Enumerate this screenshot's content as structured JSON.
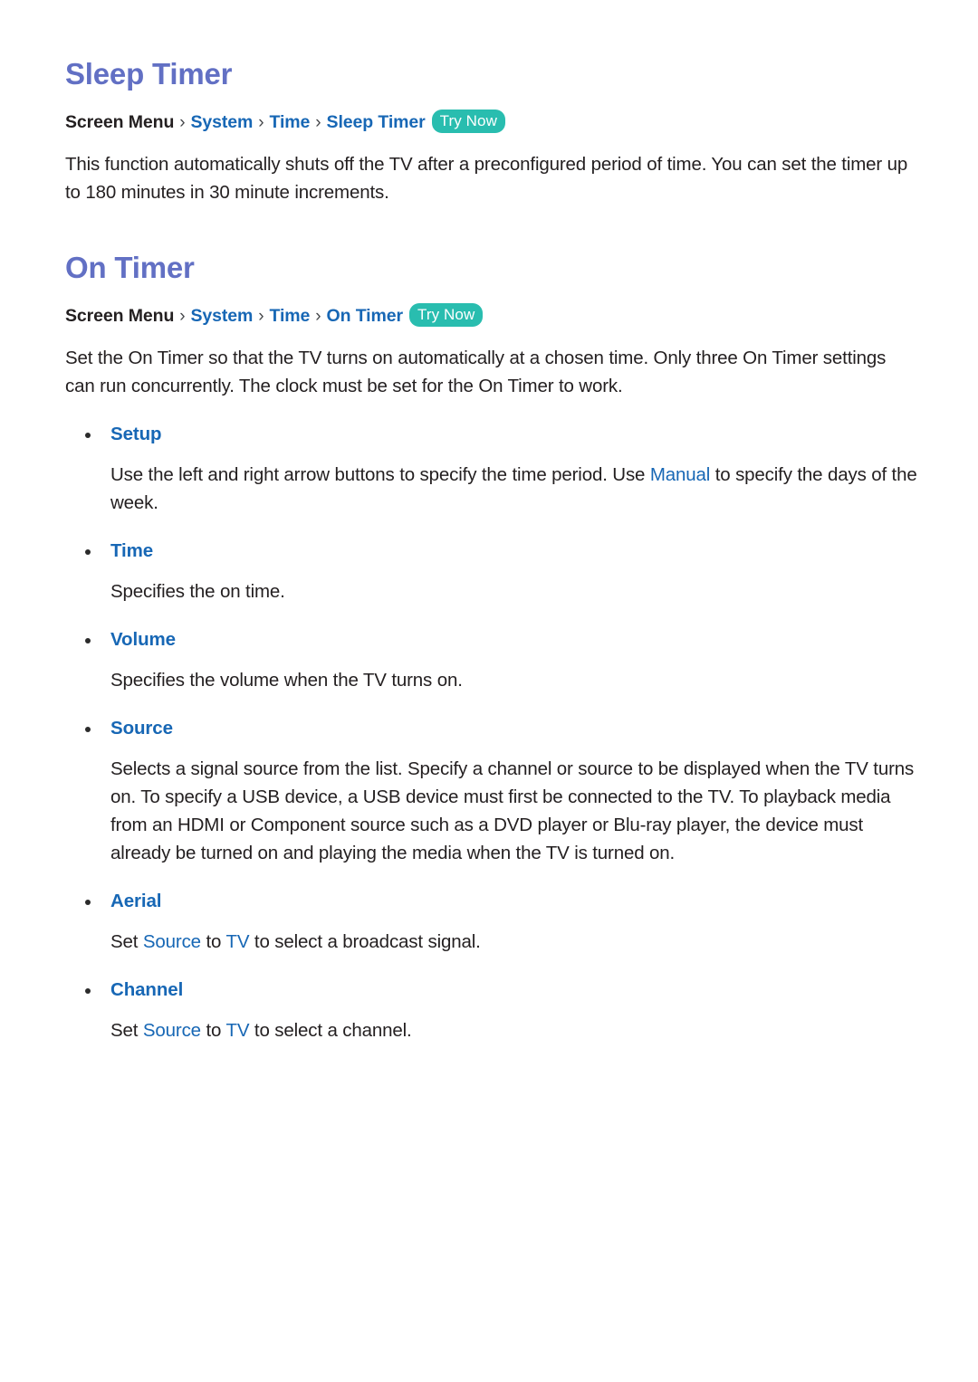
{
  "document": {
    "sections": [
      {
        "id": "sleep-timer",
        "title": "Sleep Timer",
        "breadcrumb": {
          "root": "Screen Menu",
          "separator": "›",
          "links": [
            "System",
            "Time",
            "Sleep Timer"
          ],
          "badge": "Try Now"
        },
        "paragraphs": [
          "This function automatically shuts off the TV after a preconfigured period of time. You can set the timer up to 180 minutes in 30 minute increments."
        ],
        "bullets": []
      },
      {
        "id": "on-timer",
        "title": "On Timer",
        "breadcrumb": {
          "root": "Screen Menu",
          "separator": "›",
          "links": [
            "System",
            "Time",
            "On Timer"
          ],
          "badge": "Try Now"
        },
        "paragraphs": [
          "Set the On Timer so that the TV turns on automatically at a chosen time. Only three On Timer settings can run concurrently. The clock must be set for the On Timer to work."
        ],
        "bullets": [
          {
            "label": "Setup",
            "text_before": "Use the left and right arrow buttons to specify the time period. Use ",
            "keyword1": "Manual",
            "text_middle": " to specify the days of the week.",
            "keyword2": "",
            "text_after": ""
          },
          {
            "label": "Time",
            "text_before": "Specifies the on time.",
            "keyword1": "",
            "text_middle": "",
            "keyword2": "",
            "text_after": ""
          },
          {
            "label": "Volume",
            "text_before": "Specifies the volume when the TV turns on.",
            "keyword1": "",
            "text_middle": "",
            "keyword2": "",
            "text_after": ""
          },
          {
            "label": "Source",
            "text_before": "Selects a signal source from the list. Specify a channel or source to be displayed when the TV turns on. To specify a USB device, a USB device must first be connected to the TV. To playback media from an HDMI or Component source such as a DVD player or Blu-ray player, the device must already be turned on and playing the media when the TV is turned on.",
            "keyword1": "",
            "text_middle": "",
            "keyword2": "",
            "text_after": ""
          },
          {
            "label": "Aerial",
            "text_before": "Set ",
            "keyword1": "Source",
            "text_middle": " to ",
            "keyword2": "TV",
            "text_after": " to select a broadcast signal."
          },
          {
            "label": "Channel",
            "text_before": "Set ",
            "keyword1": "Source",
            "text_middle": " to ",
            "keyword2": "TV",
            "text_after": " to select a channel."
          }
        ]
      }
    ]
  },
  "colors": {
    "heading": "#6270c4",
    "link": "#1767b5",
    "badge_background": "#29bdaf",
    "badge_text": "#ffffff",
    "body_text": "#231f20",
    "page_background": "#ffffff"
  }
}
